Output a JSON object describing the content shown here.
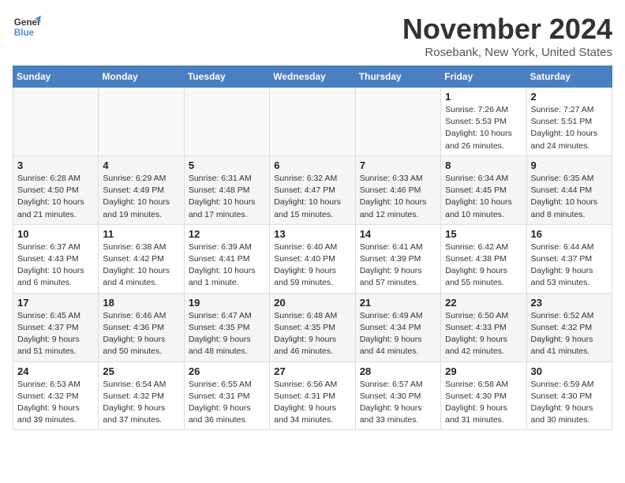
{
  "logo": {
    "line1": "General",
    "line2": "Blue"
  },
  "title": "November 2024",
  "subtitle": "Rosebank, New York, United States",
  "weekdays": [
    "Sunday",
    "Monday",
    "Tuesday",
    "Wednesday",
    "Thursday",
    "Friday",
    "Saturday"
  ],
  "weeks": [
    [
      {
        "day": "",
        "info": ""
      },
      {
        "day": "",
        "info": ""
      },
      {
        "day": "",
        "info": ""
      },
      {
        "day": "",
        "info": ""
      },
      {
        "day": "",
        "info": ""
      },
      {
        "day": "1",
        "info": "Sunrise: 7:26 AM\nSunset: 5:53 PM\nDaylight: 10 hours\nand 26 minutes."
      },
      {
        "day": "2",
        "info": "Sunrise: 7:27 AM\nSunset: 5:51 PM\nDaylight: 10 hours\nand 24 minutes."
      }
    ],
    [
      {
        "day": "3",
        "info": "Sunrise: 6:28 AM\nSunset: 4:50 PM\nDaylight: 10 hours\nand 21 minutes."
      },
      {
        "day": "4",
        "info": "Sunrise: 6:29 AM\nSunset: 4:49 PM\nDaylight: 10 hours\nand 19 minutes."
      },
      {
        "day": "5",
        "info": "Sunrise: 6:31 AM\nSunset: 4:48 PM\nDaylight: 10 hours\nand 17 minutes."
      },
      {
        "day": "6",
        "info": "Sunrise: 6:32 AM\nSunset: 4:47 PM\nDaylight: 10 hours\nand 15 minutes."
      },
      {
        "day": "7",
        "info": "Sunrise: 6:33 AM\nSunset: 4:46 PM\nDaylight: 10 hours\nand 12 minutes."
      },
      {
        "day": "8",
        "info": "Sunrise: 6:34 AM\nSunset: 4:45 PM\nDaylight: 10 hours\nand 10 minutes."
      },
      {
        "day": "9",
        "info": "Sunrise: 6:35 AM\nSunset: 4:44 PM\nDaylight: 10 hours\nand 8 minutes."
      }
    ],
    [
      {
        "day": "10",
        "info": "Sunrise: 6:37 AM\nSunset: 4:43 PM\nDaylight: 10 hours\nand 6 minutes."
      },
      {
        "day": "11",
        "info": "Sunrise: 6:38 AM\nSunset: 4:42 PM\nDaylight: 10 hours\nand 4 minutes."
      },
      {
        "day": "12",
        "info": "Sunrise: 6:39 AM\nSunset: 4:41 PM\nDaylight: 10 hours\nand 1 minute."
      },
      {
        "day": "13",
        "info": "Sunrise: 6:40 AM\nSunset: 4:40 PM\nDaylight: 9 hours\nand 59 minutes."
      },
      {
        "day": "14",
        "info": "Sunrise: 6:41 AM\nSunset: 4:39 PM\nDaylight: 9 hours\nand 57 minutes."
      },
      {
        "day": "15",
        "info": "Sunrise: 6:42 AM\nSunset: 4:38 PM\nDaylight: 9 hours\nand 55 minutes."
      },
      {
        "day": "16",
        "info": "Sunrise: 6:44 AM\nSunset: 4:37 PM\nDaylight: 9 hours\nand 53 minutes."
      }
    ],
    [
      {
        "day": "17",
        "info": "Sunrise: 6:45 AM\nSunset: 4:37 PM\nDaylight: 9 hours\nand 51 minutes."
      },
      {
        "day": "18",
        "info": "Sunrise: 6:46 AM\nSunset: 4:36 PM\nDaylight: 9 hours\nand 50 minutes."
      },
      {
        "day": "19",
        "info": "Sunrise: 6:47 AM\nSunset: 4:35 PM\nDaylight: 9 hours\nand 48 minutes."
      },
      {
        "day": "20",
        "info": "Sunrise: 6:48 AM\nSunset: 4:35 PM\nDaylight: 9 hours\nand 46 minutes."
      },
      {
        "day": "21",
        "info": "Sunrise: 6:49 AM\nSunset: 4:34 PM\nDaylight: 9 hours\nand 44 minutes."
      },
      {
        "day": "22",
        "info": "Sunrise: 6:50 AM\nSunset: 4:33 PM\nDaylight: 9 hours\nand 42 minutes."
      },
      {
        "day": "23",
        "info": "Sunrise: 6:52 AM\nSunset: 4:32 PM\nDaylight: 9 hours\nand 41 minutes."
      }
    ],
    [
      {
        "day": "24",
        "info": "Sunrise: 6:53 AM\nSunset: 4:32 PM\nDaylight: 9 hours\nand 39 minutes."
      },
      {
        "day": "25",
        "info": "Sunrise: 6:54 AM\nSunset: 4:32 PM\nDaylight: 9 hours\nand 37 minutes."
      },
      {
        "day": "26",
        "info": "Sunrise: 6:55 AM\nSunset: 4:31 PM\nDaylight: 9 hours\nand 36 minutes."
      },
      {
        "day": "27",
        "info": "Sunrise: 6:56 AM\nSunset: 4:31 PM\nDaylight: 9 hours\nand 34 minutes."
      },
      {
        "day": "28",
        "info": "Sunrise: 6:57 AM\nSunset: 4:30 PM\nDaylight: 9 hours\nand 33 minutes."
      },
      {
        "day": "29",
        "info": "Sunrise: 6:58 AM\nSunset: 4:30 PM\nDaylight: 9 hours\nand 31 minutes."
      },
      {
        "day": "30",
        "info": "Sunrise: 6:59 AM\nSunset: 4:30 PM\nDaylight: 9 hours\nand 30 minutes."
      }
    ]
  ]
}
